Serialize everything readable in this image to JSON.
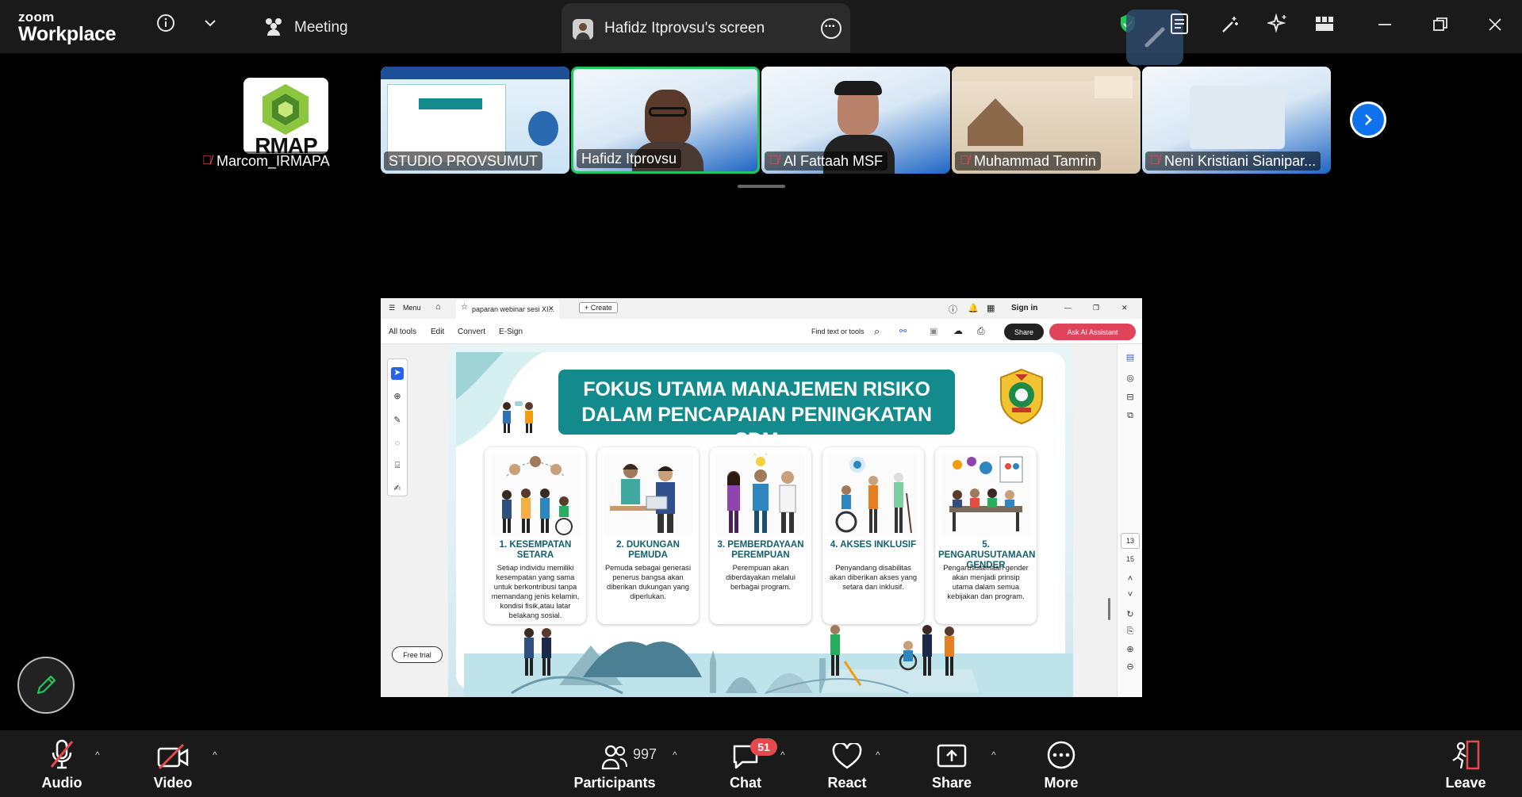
{
  "app": {
    "brand_line1": "zoom",
    "brand_line2": "Workplace",
    "meeting_label": "Meeting",
    "shared_screen_title": "Hafidz Itprovsu's screen"
  },
  "colors": {
    "accent": "#0e72ed",
    "mute_red": "#e5484d",
    "slide_teal": "#138a8c",
    "active_speaker": "#22c55e"
  },
  "participants_strip": [
    {
      "name": "Marcom_IRMAPA",
      "muted": true,
      "avatar_text": "RMAP"
    },
    {
      "name": "STUDIO PROVSUMUT",
      "muted": false
    },
    {
      "name": "Hafidz Itprovsu",
      "muted": false,
      "active": true
    },
    {
      "name": "Al Fattaah MSF",
      "muted": true
    },
    {
      "name": "Muhammad Tamrin",
      "muted": true
    },
    {
      "name": "Neni Kristiani Sianipar...",
      "muted": true
    }
  ],
  "viewer": {
    "tab_menu": "Menu",
    "tab_title": "paparan webinar sesi XI...",
    "tab_create": "+ Create",
    "sign_in": "Sign in",
    "toolbar": {
      "all_tools": "All tools",
      "edit": "Edit",
      "convert": "Convert",
      "esign": "E-Sign",
      "find": "Find text or tools",
      "share": "Share",
      "ai": "Ask AI Assistant"
    },
    "free_trial": "Free trial",
    "page_current": "13",
    "page_total": "15"
  },
  "slide": {
    "title_line1": "FOKUS UTAMA MANAJEMEN RISIKO",
    "title_line2": "DALAM PENCAPAIAN PENINGKATAN SDM",
    "cards": [
      {
        "title": "1. KESEMPATAN SETARA",
        "text": "Setiap individu memiliki kesempatan yang sama untuk berkontribusi tanpa memandang jenis kelamin, kondisi fisik,atau latar belakang sosial."
      },
      {
        "title": "2. DUKUNGAN PEMUDA",
        "text": "Pemuda sebagai generasi penerus bangsa akan diberikan dukungan yang diperlukan."
      },
      {
        "title": "3. PEMBERDAYAAN PEREMPUAN",
        "text": "Perempuan akan diberdayakan melalui berbagai program."
      },
      {
        "title": "4. AKSES INKLUSIF",
        "text": "Penyandang disabilitas akan diberikan akses yang setara dan inklusif."
      },
      {
        "title": "5. PENGARUSUTAMAAN GENDER",
        "text": "Pengarusutamaan gender akan menjadi prinsip utama dalam semua kebijakan dan program."
      }
    ]
  },
  "bottom": {
    "audio": "Audio",
    "video": "Video",
    "participants": "Participants",
    "participants_count": "997",
    "chat": "Chat",
    "chat_badge": "51",
    "react": "React",
    "share": "Share",
    "more": "More",
    "leave": "Leave"
  }
}
